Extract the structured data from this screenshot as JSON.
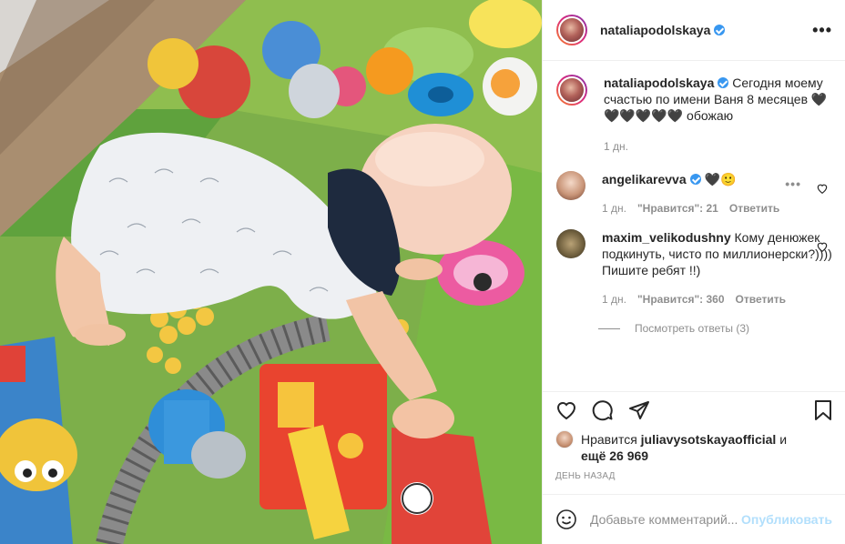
{
  "post": {
    "author": "nataliapodolskaya",
    "caption": "Сегодня моему счастью по имени Ваня 8 месяцев 🖤🖤🖤🖤🖤🖤 обожаю",
    "time": "1 дн."
  },
  "comments": [
    {
      "user": "angelikarevva",
      "text": "🖤🙂",
      "time": "1 дн.",
      "likes": "\"Нравится\": 21",
      "reply": "Ответить"
    },
    {
      "user": "maxim_velikodushny",
      "text": "Кому денюжек подкинуть, чисто по миллионерски?))))",
      "text2": "Пишите ребят !!)",
      "time": "1 дн.",
      "likes": "\"Нравится\": 360",
      "reply": "Ответить",
      "view_replies": "Посмотреть ответы (3)"
    }
  ],
  "likes": {
    "prefix": "Нравится",
    "user": "juliavysotskayaofficial",
    "mid": "и",
    "rest": "ещё 26 969"
  },
  "date": "ДЕНЬ НАЗАД",
  "add_comment": {
    "placeholder": "Добавьте комментарий...",
    "publish": "Опубликовать"
  },
  "icons": {
    "like": "heart-icon",
    "comment": "comment-icon",
    "share": "share-icon",
    "save": "bookmark-icon",
    "emoji": "smile-icon",
    "more": "more-icon"
  },
  "colors": {
    "verified": "#3897f0",
    "muted": "#8e8e8e",
    "publish": "#b2dffc"
  }
}
